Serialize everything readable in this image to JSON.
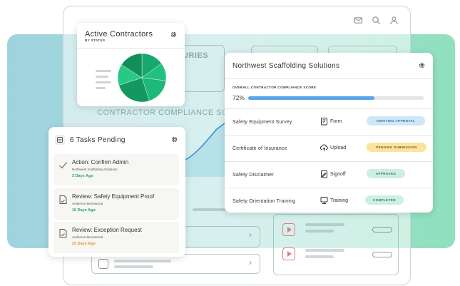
{
  "background_panels": {
    "injuries_label": "URIES",
    "compliance_label": "CONTRACTOR COMPLIANCE SCORE"
  },
  "active_contractors": {
    "title": "Active Contractors",
    "subtitle": "BY STATUS",
    "pie_colors": [
      "#17a870",
      "#22c07f",
      "#1db978",
      "#13985f",
      "#28c985",
      "#109058"
    ]
  },
  "northwest": {
    "title": "Northwest Scaffolding Solutions",
    "overall_label": "OVERALL CONTRACTOR COMPLIANCE SCORE",
    "score_text": "72%",
    "score_value": 0.72,
    "rows": [
      {
        "name": "Safety Equipment Survey",
        "type": "Form",
        "type_icon": "form-icon",
        "status": "AWAITING APPROVAL",
        "status_bg": "#cfe6f7",
        "status_fg": "#2f6f9c"
      },
      {
        "name": "Certificate of Insurance",
        "type": "Upload",
        "type_icon": "upload-icon",
        "status": "PENDING SUBMISSION",
        "status_bg": "#fbe3a0",
        "status_fg": "#7a5b10"
      },
      {
        "name": "Safety Disclaimer",
        "type": "Signoff",
        "type_icon": "signoff-icon",
        "status": "APPROVED",
        "status_bg": "#cdeee0",
        "status_fg": "#2b7a56"
      },
      {
        "name": "Safety Orientation Training",
        "type": "Training",
        "type_icon": "training-icon",
        "status": "COMPLETED",
        "status_bg": "#cdeee0",
        "status_fg": "#2b7a56"
      }
    ]
  },
  "tasks": {
    "title": "6 Tasks Pending",
    "items": [
      {
        "title": "Action: Confirm Admin",
        "detail": "Northwest Scaffolding Solutions",
        "age": "3 Days Ago",
        "age_color": "#25a36a",
        "icon": "check-icon"
      },
      {
        "title": "Review: Safety Equipment Proof",
        "detail": "Anderson Mechanical",
        "age": "10 Days Ago",
        "age_color": "#25a36a",
        "icon": "document-icon"
      },
      {
        "title": "Review: Exception Request",
        "detail": "Anderson Mechanical",
        "age": "25 Days Ago",
        "age_color": "#e8962c",
        "icon": "document-icon"
      }
    ]
  }
}
